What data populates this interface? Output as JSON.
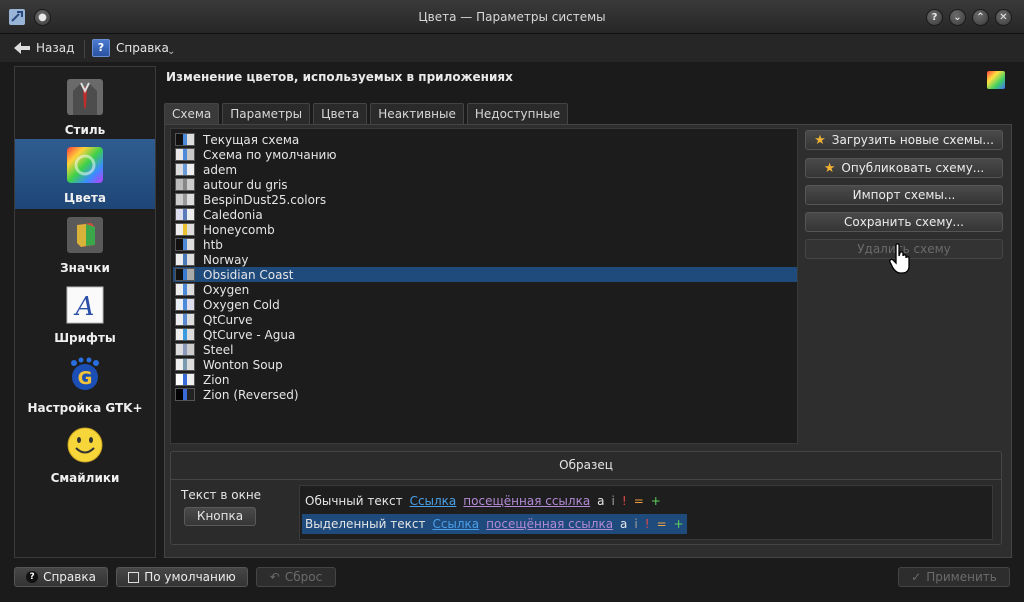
{
  "window": {
    "title": "Цвета — Параметры системы",
    "buttons": [
      "?",
      "⌄",
      "⌃",
      "✕"
    ]
  },
  "toolbar": {
    "back_label": "Назад",
    "help_label": "Справка"
  },
  "sidebar": {
    "items": [
      {
        "label": "Стиль",
        "icon": "suit-icon"
      },
      {
        "label": "Цвета",
        "icon": "color-wheel-icon"
      },
      {
        "label": "Значки",
        "icon": "icons-icon"
      },
      {
        "label": "Шрифты",
        "icon": "font-icon"
      },
      {
        "label": "Настройка GTK+",
        "icon": "gtk-icon"
      },
      {
        "label": "Смайлики",
        "icon": "smiley-icon"
      }
    ],
    "selected_index": 1
  },
  "main": {
    "heading": "Изменение цветов, используемых в приложениях",
    "tabs": [
      "Схема",
      "Параметры",
      "Цвета",
      "Неактивные",
      "Недоступные"
    ],
    "active_tab": 0,
    "schemes": [
      "Текущая схема",
      "Схема по умолчанию",
      "adem",
      "autour du gris",
      "BespinDust25.colors",
      "Caledonia",
      "Honeycomb",
      "htb",
      "Norway",
      "Obsidian Coast",
      "Oxygen",
      "Oxygen Cold",
      "QtCurve",
      "QtCurve - Agua",
      "Steel",
      "Wonton Soup",
      "Zion",
      "Zion (Reversed)"
    ],
    "selected_scheme": "Obsidian Coast",
    "buttons": {
      "get_new": "Загрузить новые схемы...",
      "publish": "Опубликовать схему...",
      "import": "Импорт схемы...",
      "save": "Сохранить схему...",
      "delete": "Удалить схему"
    }
  },
  "sample": {
    "title": "Образец",
    "window_text_label": "Текст в окне",
    "button_label": "Кнопка",
    "normal_text": "Обычный текст",
    "selected_text": "Выделенный текст",
    "link": "Ссылка",
    "visited_link": "посещённая ссылка",
    "active": "a",
    "inactive": "i",
    "negative": "!",
    "neutral": "=",
    "positive": "+"
  },
  "footer": {
    "help": "Справка",
    "defaults": "По умолчанию",
    "reset": "Сброс",
    "apply": "Применить"
  },
  "colors": {
    "selection": "#1f4a7c",
    "link": "#4aa0e8",
    "visited": "#b38ad6",
    "star": "#f2b233"
  }
}
